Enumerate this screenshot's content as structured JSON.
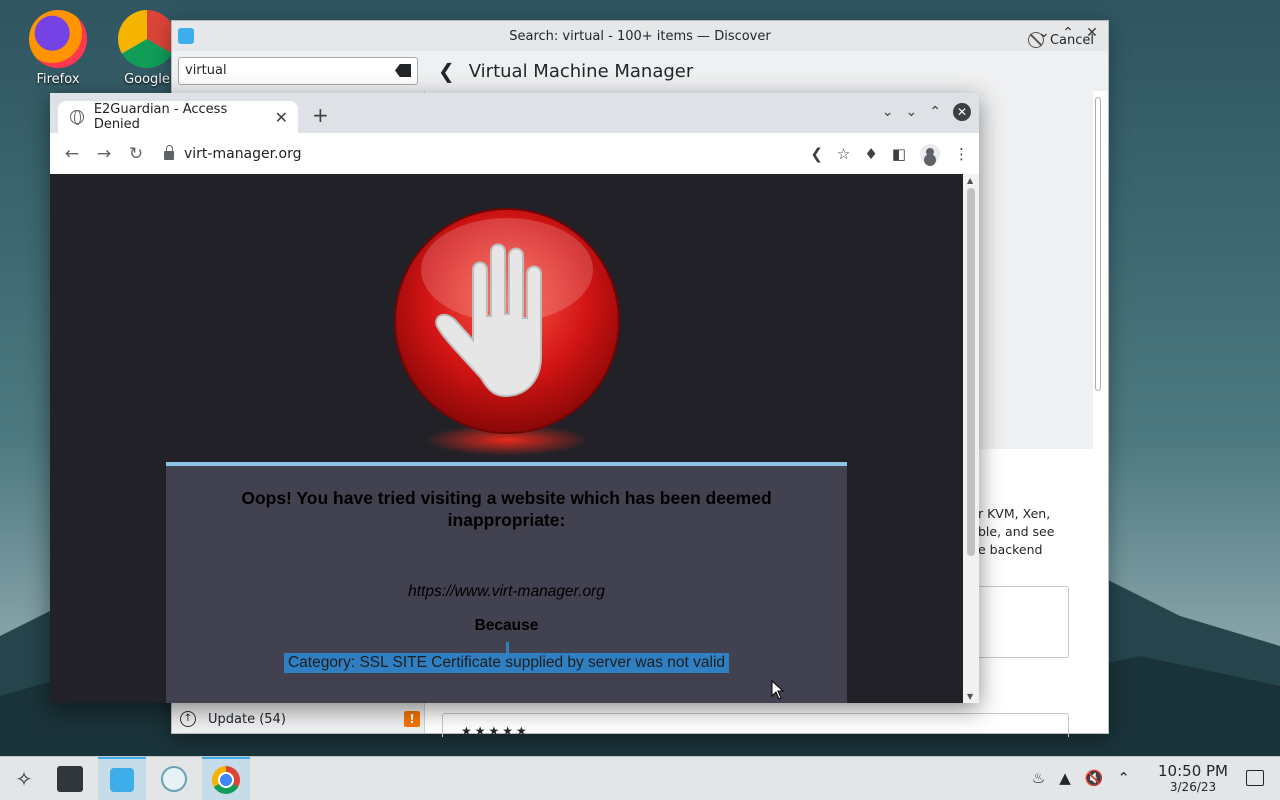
{
  "desktop": {
    "icons": [
      {
        "label": "Firefox"
      },
      {
        "label": "Google"
      }
    ]
  },
  "discover": {
    "window_title": "Search: virtual - 100+ items — Discover",
    "search_value": "virtual",
    "page_title": "Virtual Machine Manager",
    "cancel_label": "Cancel",
    "description_fragment": [
      "r KVM, Xen,",
      "ble, and see",
      "e backend"
    ],
    "update_label": "Update (54)",
    "update_badge": "!",
    "rating_stars": "★★★★★"
  },
  "chrome": {
    "tab_title": "E2Guardian - Access Denied",
    "url": "virt-manager.org",
    "page": {
      "heading": "Oops! You have tried visiting a website which has been deemed inappropriate:",
      "blocked_url": "https://www.virt-manager.org",
      "because_label": "Because",
      "reason": "Category: SSL SITE   Certificate supplied by server was not valid"
    }
  },
  "taskbar": {
    "time": "10:50 PM",
    "date": "3/26/23"
  },
  "colors": {
    "accent": "#3daee9",
    "blocked_page_bg": "#212127",
    "panel_bg": "#41414f",
    "selection": "#2f7fc2",
    "stop_red": "#e02020"
  }
}
